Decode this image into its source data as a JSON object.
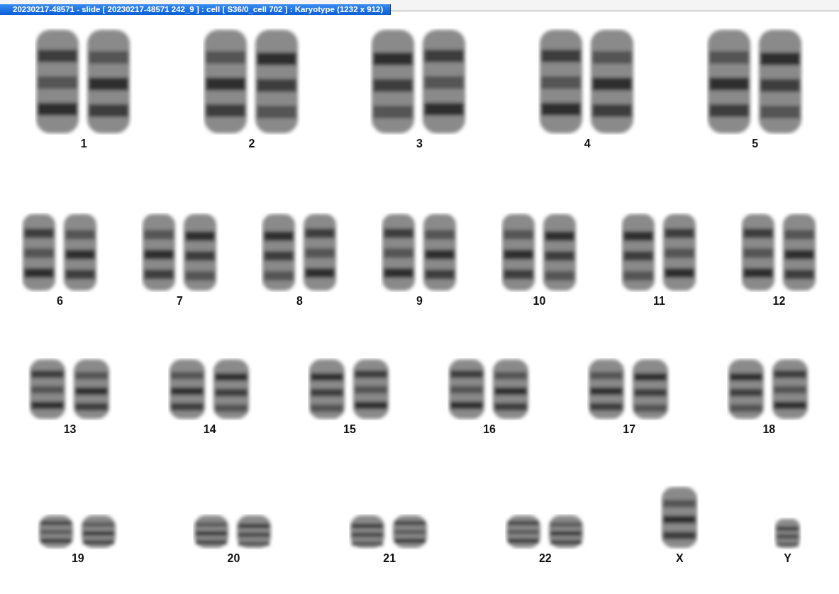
{
  "window": {
    "title": "20230217-48571 - slide [ 20230217-48571 242_9 ] : cell [ S36/0_cell 702 ] : Karyotype  (1232 x 912)"
  },
  "karyotype": {
    "rows": [
      {
        "groups": [
          {
            "label": "1",
            "kind": "pair"
          },
          {
            "label": "2",
            "kind": "pair"
          },
          {
            "label": "3",
            "kind": "pair"
          },
          {
            "label": "4",
            "kind": "pair"
          },
          {
            "label": "5",
            "kind": "pair"
          }
        ]
      },
      {
        "groups": [
          {
            "label": "6",
            "kind": "pair"
          },
          {
            "label": "7",
            "kind": "pair"
          },
          {
            "label": "8",
            "kind": "pair"
          },
          {
            "label": "9",
            "kind": "pair"
          },
          {
            "label": "10",
            "kind": "pair"
          },
          {
            "label": "11",
            "kind": "pair"
          },
          {
            "label": "12",
            "kind": "pair"
          }
        ]
      },
      {
        "groups": [
          {
            "label": "13",
            "kind": "pair"
          },
          {
            "label": "14",
            "kind": "pair"
          },
          {
            "label": "15",
            "kind": "pair"
          },
          {
            "label": "16",
            "kind": "pair"
          },
          {
            "label": "17",
            "kind": "pair"
          },
          {
            "label": "18",
            "kind": "pair"
          }
        ]
      },
      {
        "groups": [
          {
            "label": "19",
            "kind": "pair"
          },
          {
            "label": "20",
            "kind": "pair"
          },
          {
            "label": "21",
            "kind": "pair"
          },
          {
            "label": "22",
            "kind": "pair"
          },
          {
            "label": "X",
            "kind": "single"
          },
          {
            "label": "Y",
            "kind": "single"
          }
        ]
      }
    ]
  }
}
